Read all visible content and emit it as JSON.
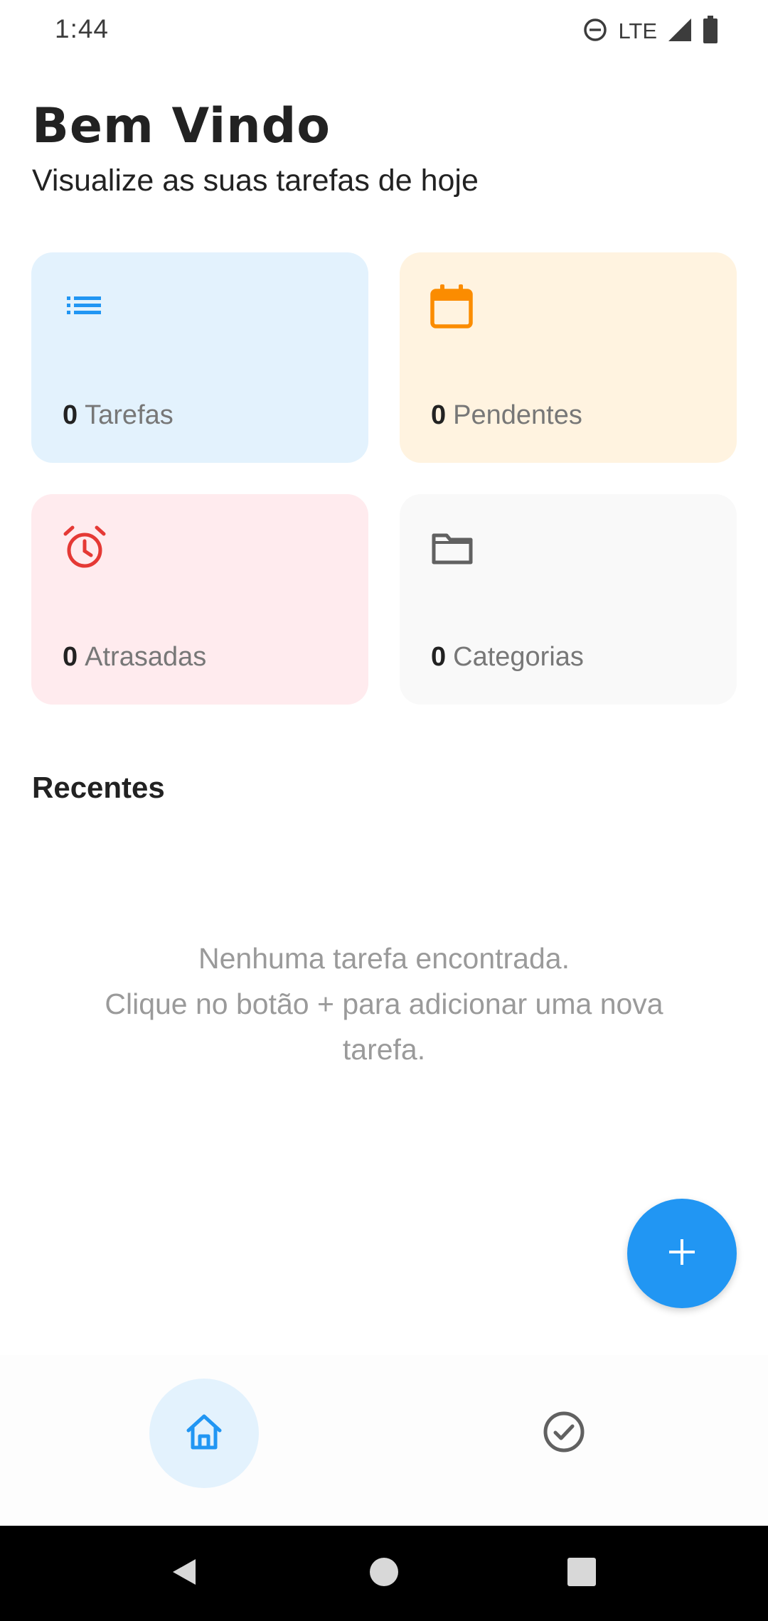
{
  "status_bar": {
    "time": "1:44",
    "network": "LTE"
  },
  "header": {
    "title": "Bem Vindo",
    "subtitle": "Visualize as suas tarefas de hoje"
  },
  "cards": [
    {
      "count": "0",
      "label": "Tarefas",
      "icon": "list-icon",
      "color": "#2196f3",
      "background": "#e3f2fd"
    },
    {
      "count": "0",
      "label": "Pendentes",
      "icon": "calendar-icon",
      "color": "#fb8c00",
      "background": "#fff3e0"
    },
    {
      "count": "0",
      "label": "Atrasadas",
      "icon": "alarm-icon",
      "color": "#e53935",
      "background": "#ffebee"
    },
    {
      "count": "0",
      "label": "Categorias",
      "icon": "folder-icon",
      "color": "#616161",
      "background": "#f9f9f9"
    }
  ],
  "recent": {
    "title": "Recentes",
    "empty_line1": "Nenhuma tarefa encontrada.",
    "empty_line2": "Clique no botão + para adicionar uma nova tarefa."
  },
  "colors": {
    "accent": "#2196f3"
  },
  "icons": {
    "fab": "plus-icon",
    "nav_home": "home-icon",
    "nav_tasks": "check-circle-icon",
    "status": [
      "do-not-disturb-icon",
      "signal-icon",
      "battery-icon"
    ],
    "system_nav": [
      "back-icon",
      "home-circle-icon",
      "recents-icon"
    ]
  }
}
